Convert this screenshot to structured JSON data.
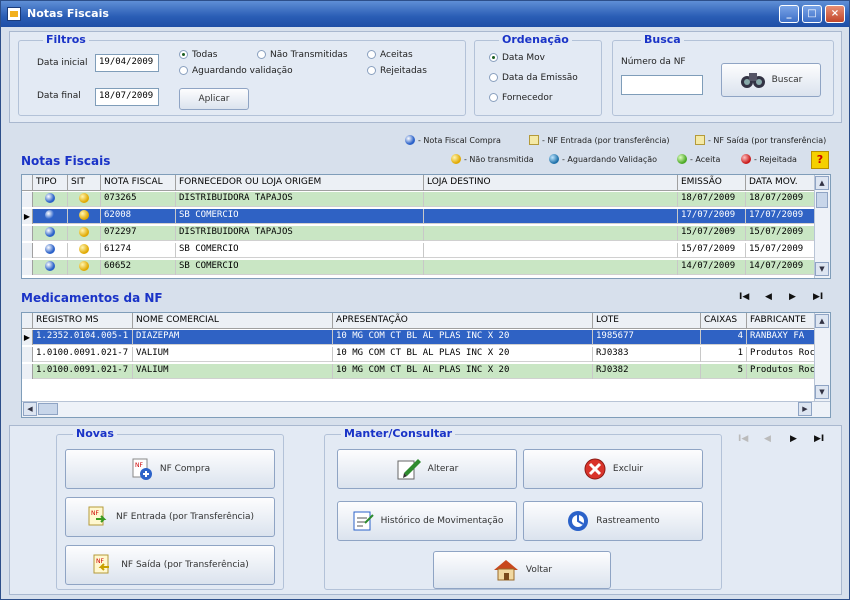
{
  "window": {
    "title": "Notas Fiscais"
  },
  "filtros": {
    "title": "Filtros",
    "data_inicial_label": "Data inicial",
    "data_inicial": "19/04/2009",
    "data_final_label": "Data final",
    "data_final": "18/07/2009",
    "radios": [
      "Todas",
      "Não Transmitidas",
      "Aceitas",
      "Aguardando validação",
      "Rejeitadas"
    ],
    "aplicar": "Aplicar"
  },
  "ordenacao": {
    "title": "Ordenação",
    "options": [
      "Data Mov",
      "Data da Emissão",
      "Fornecedor"
    ]
  },
  "busca": {
    "title": "Busca",
    "numero_label": "Número da NF",
    "numero_value": "",
    "buscar": "Buscar"
  },
  "legend": {
    "nf_compra": "- Nota Fiscal Compra",
    "nf_entrada": "- NF Entrada (por transferência)",
    "nf_saida": "- NF Saída (por transferência)",
    "nao_transmitida": "- Não transmitida",
    "aguardando": "- Aguardando Validação",
    "aceita": "- Aceita",
    "rejeitada": "- Rejeitada",
    "help": "?"
  },
  "notas": {
    "title": "Notas Fiscais",
    "columns": [
      "TIPO",
      "SIT",
      "NOTA FISCAL",
      "FORNECEDOR OU LOJA ORIGEM",
      "LOJA DESTINO",
      "EMISSÃO",
      "DATA MOV."
    ],
    "rows": [
      {
        "nf": "073265",
        "fornecedor": "DISTRIBUIDORA TAPAJOS",
        "destino": "",
        "emissao": "18/07/2009",
        "mov": "18/07/2009"
      },
      {
        "nf": "62008",
        "fornecedor": "SB COMERCIO",
        "destino": "",
        "emissao": "17/07/2009",
        "mov": "17/07/2009"
      },
      {
        "nf": "072297",
        "fornecedor": "DISTRIBUIDORA TAPAJOS",
        "destino": "",
        "emissao": "15/07/2009",
        "mov": "15/07/2009"
      },
      {
        "nf": "61274",
        "fornecedor": "SB COMERCIO",
        "destino": "",
        "emissao": "15/07/2009",
        "mov": "15/07/2009"
      },
      {
        "nf": "60652",
        "fornecedor": "SB COMERCIO",
        "destino": "",
        "emissao": "14/07/2009",
        "mov": "14/07/2009"
      }
    ]
  },
  "medicamentos": {
    "title": "Medicamentos da NF",
    "columns": [
      "REGISTRO MS",
      "NOME COMERCIAL",
      "APRESENTAÇÃO",
      "LOTE",
      "CAIXAS",
      "FABRICANTE"
    ],
    "rows": [
      {
        "registro": "1.2352.0104.005-1",
        "nome": "DIAZEPAM",
        "apresentacao": "10 MG COM CT BL AL PLAS INC X 20",
        "lote": "1985677",
        "caixas": "4",
        "fabricante": "RANBAXY FA"
      },
      {
        "registro": "1.0100.0091.021-7",
        "nome": "VALIUM",
        "apresentacao": "10 MG COM CT BL AL PLAS INC X 20",
        "lote": "RJ0383",
        "caixas": "1",
        "fabricante": "Produtos Roc"
      },
      {
        "registro": "1.0100.0091.021-7",
        "nome": "VALIUM",
        "apresentacao": "10 MG COM CT BL AL PLAS INC X 20",
        "lote": "RJ0382",
        "caixas": "5",
        "fabricante": "Produtos Roc"
      }
    ]
  },
  "nav": {
    "first": "I◀",
    "prev": "◀",
    "next": "▶",
    "last": "▶I"
  },
  "novas": {
    "title": "Novas",
    "nf_compra": "NF Compra",
    "nf_entrada": "NF Entrada (por Transferência)",
    "nf_saida": "NF Saída (por Transferência)"
  },
  "manter": {
    "title": "Manter/Consultar",
    "alterar": "Alterar",
    "excluir": "Excluir",
    "historico": "Histórico de Movimentação",
    "rastreamento": "Rastreamento",
    "voltar": "Voltar"
  },
  "colors": {
    "title_blue": "#1a33c7",
    "row_green": "#c9e6c4",
    "selection": "#2f62c4"
  }
}
